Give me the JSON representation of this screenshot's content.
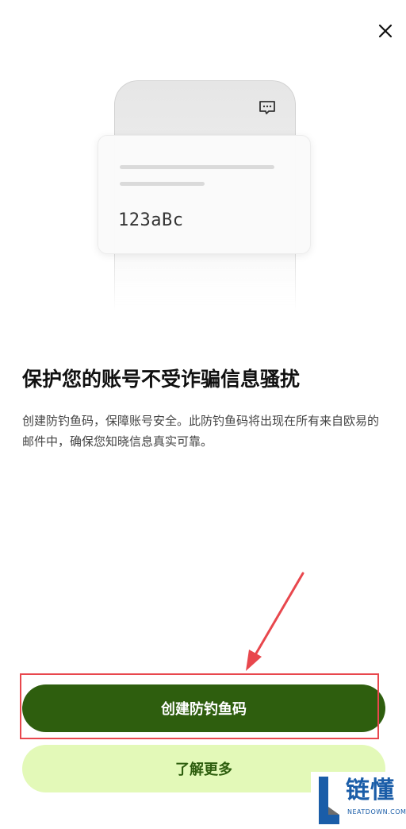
{
  "header": {
    "close_icon": "close-icon"
  },
  "illustration": {
    "message_icon": "message-icon",
    "anti_phishing_code": "123aBc"
  },
  "content": {
    "title": "保护您的账号不受诈骗信息骚扰",
    "description": "创建防钓鱼码，保障账号安全。此防钓鱼码将出现在所有来自欧易的邮件中，确保您知晓信息真实可靠。"
  },
  "actions": {
    "primary_label": "创建防钓鱼码",
    "secondary_label": "了解更多"
  },
  "watermark": {
    "brand": "链懂",
    "site": "NEATDOWN.COM"
  },
  "colors": {
    "primary_button": "#2e5e0e",
    "secondary_button": "#e3f9b8",
    "annotation": "#e8474d",
    "watermark": "#1a5da8"
  }
}
